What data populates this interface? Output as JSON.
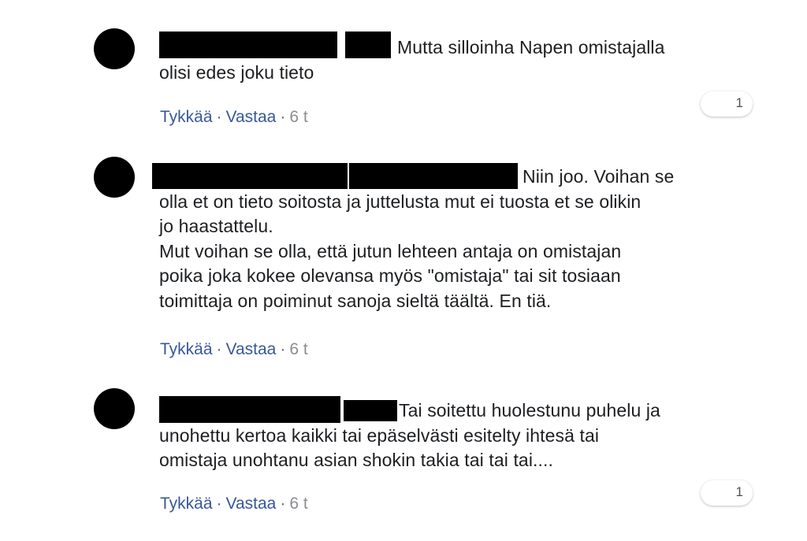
{
  "comments": [
    {
      "lines": [
        "Mutta silloinha Napen omistajalla",
        "olisi edes joku tieto"
      ],
      "actions": {
        "like": "Tykkää",
        "reply": "Vastaa",
        "time": "6 t",
        "sep": "·"
      },
      "reaction_count": "1"
    },
    {
      "lines": [
        "Niin joo. Voihan se",
        "olla et on tieto soitosta ja juttelusta mut ei tuosta et se olikin",
        "jo haastattelu.",
        "Mut voihan se olla, että jutun lehteen antaja on omistajan",
        "poika joka kokee olevansa myös \"omistaja\" tai sit tosiaan",
        "toimittaja on poiminut sanoja sieltä täältä. En tiä."
      ],
      "actions": {
        "like": "Tykkää",
        "reply": "Vastaa",
        "time": "6 t",
        "sep": "·"
      }
    },
    {
      "lines": [
        "Tai soitettu huolestunu puhelu ja",
        "unohettu kertoa kaikki tai epäselvästi esitelty ihtesä tai",
        "omistaja unohtanu asian shokin takia tai tai tai...."
      ],
      "actions": {
        "like": "Tykkää",
        "reply": "Vastaa",
        "time": "6 t",
        "sep": "·"
      },
      "reaction_count": "1"
    }
  ]
}
